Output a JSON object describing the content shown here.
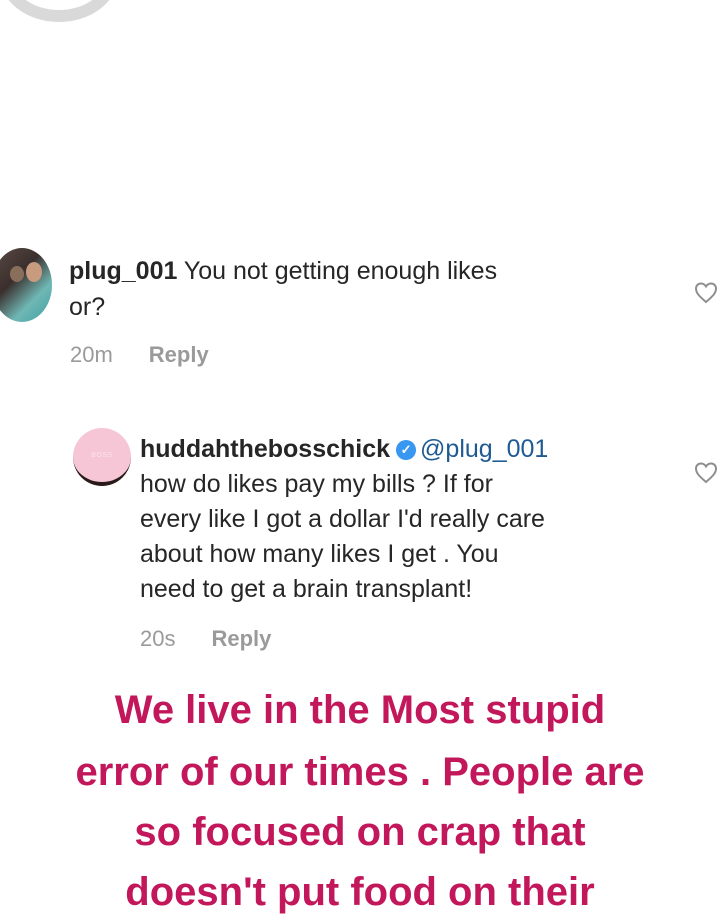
{
  "comments": [
    {
      "username": "plug_001",
      "text_line1": " You not getting enough likes",
      "text_line2": "or?",
      "time": "20m",
      "reply_label": "Reply"
    },
    {
      "username": "huddahthebosschick",
      "verified_glyph": "✓",
      "avatar_logo_text": "BOSS",
      "mention": "@plug_001",
      "lines": [
        "how do likes pay my bills ? If for",
        "every like I got a dollar I'd really care",
        "about how many likes I get . You",
        "need to get a brain transplant!"
      ],
      "time": "20s",
      "reply_label": "Reply"
    }
  ],
  "story_caption": {
    "lines": [
      "We live in the Most stupid",
      "error of our times . People are",
      "so focused on crap that",
      "doesn't put food on their"
    ],
    "color": "#c2185b"
  },
  "icons": {
    "like": "heart-outline-icon",
    "verified": "verified-badge-icon"
  }
}
